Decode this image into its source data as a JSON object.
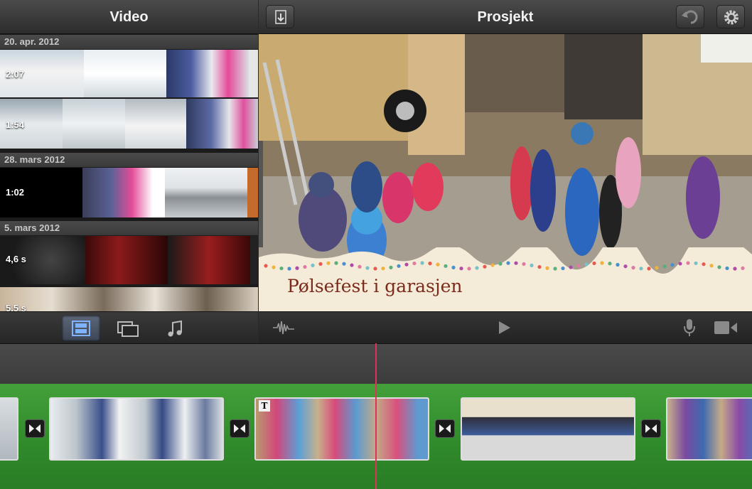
{
  "library": {
    "title": "Video",
    "groups": [
      {
        "date": "20. apr. 2012",
        "clips": [
          {
            "duration": "2:07"
          },
          {
            "duration": "1:54"
          }
        ]
      },
      {
        "date": "28. mars 2012",
        "clips": [
          {
            "duration": "1:02"
          }
        ]
      },
      {
        "date": "5. mars 2012",
        "clips": [
          {
            "duration": "4,6 s"
          },
          {
            "duration": "5,5 s"
          }
        ]
      }
    ],
    "toolbar": [
      {
        "icon": "film-strip-icon",
        "active": true
      },
      {
        "icon": "photos-icon",
        "active": false
      },
      {
        "icon": "music-note-icon",
        "active": false
      }
    ]
  },
  "project": {
    "title": "Prosjekt",
    "undo_icon": "undo-icon",
    "settings_icon": "gear-icon",
    "import_icon": "import-icon",
    "title_overlay": "Pølsefest i garasjen"
  },
  "transport": {
    "audio_icon": "waveform-icon",
    "play_icon": "play-icon",
    "mic_icon": "microphone-icon",
    "camera_icon": "video-camera-icon"
  },
  "timeline": {
    "title_badge": "T",
    "transition_icon": "transition-bowtie-icon",
    "playhead_color": "#e1305a"
  },
  "colors": {
    "timeline_green": "#2f8a2a",
    "active_tab": "#4a5566",
    "title_text": "#7c2a1c"
  }
}
